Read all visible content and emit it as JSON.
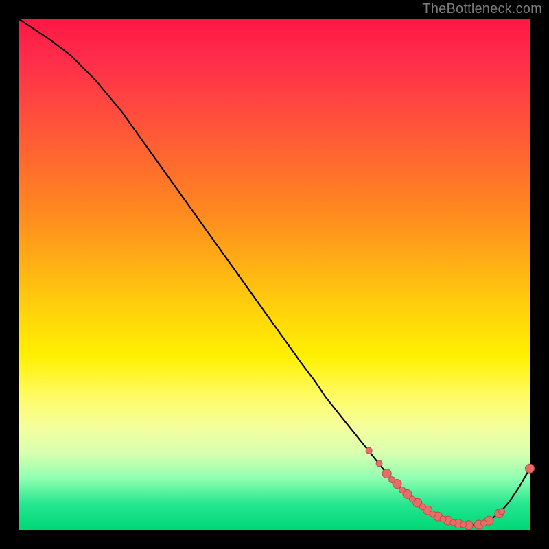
{
  "watermark": "TheBottleneck.com",
  "colors": {
    "point_fill": "#e86d66",
    "point_stroke": "#b94e49",
    "curve": "#000000"
  },
  "chart_data": {
    "type": "line",
    "title": "",
    "xlabel": "",
    "ylabel": "",
    "xlim": [
      0,
      100
    ],
    "ylim": [
      0,
      100
    ],
    "grid": false,
    "legend": false,
    "x": [
      0,
      3,
      6,
      10,
      15,
      20,
      25,
      30,
      35,
      40,
      45,
      50,
      55,
      58,
      60,
      62,
      64,
      66,
      68,
      70,
      72,
      74,
      76,
      78,
      80,
      82,
      84,
      86,
      88,
      90,
      92,
      94,
      96,
      98,
      100
    ],
    "values": [
      100,
      98,
      96,
      93,
      88,
      82,
      75,
      68,
      61,
      54,
      47,
      40,
      33,
      29,
      26,
      23.5,
      21,
      18.5,
      16,
      13.5,
      11,
      9,
      7,
      5.3,
      3.8,
      2.6,
      1.8,
      1.2,
      0.9,
      1.0,
      1.8,
      3.2,
      5.5,
      8.5,
      12
    ],
    "marker_indices": [
      20,
      21,
      22,
      23,
      24,
      25,
      26,
      27,
      28,
      29,
      30,
      31,
      34
    ],
    "extra_marker_points": [
      {
        "x": 68.5,
        "y": 15.5
      },
      {
        "x": 70.5,
        "y": 13.0
      },
      {
        "x": 73.0,
        "y": 9.8
      },
      {
        "x": 75.0,
        "y": 7.8
      },
      {
        "x": 77.0,
        "y": 6.0
      },
      {
        "x": 79.0,
        "y": 4.5
      },
      {
        "x": 81.0,
        "y": 3.1
      },
      {
        "x": 83.0,
        "y": 2.1
      },
      {
        "x": 85.0,
        "y": 1.4
      },
      {
        "x": 87.0,
        "y": 1.0
      },
      {
        "x": 91.0,
        "y": 1.3
      },
      {
        "x": 94.5,
        "y": 3.6
      }
    ]
  }
}
